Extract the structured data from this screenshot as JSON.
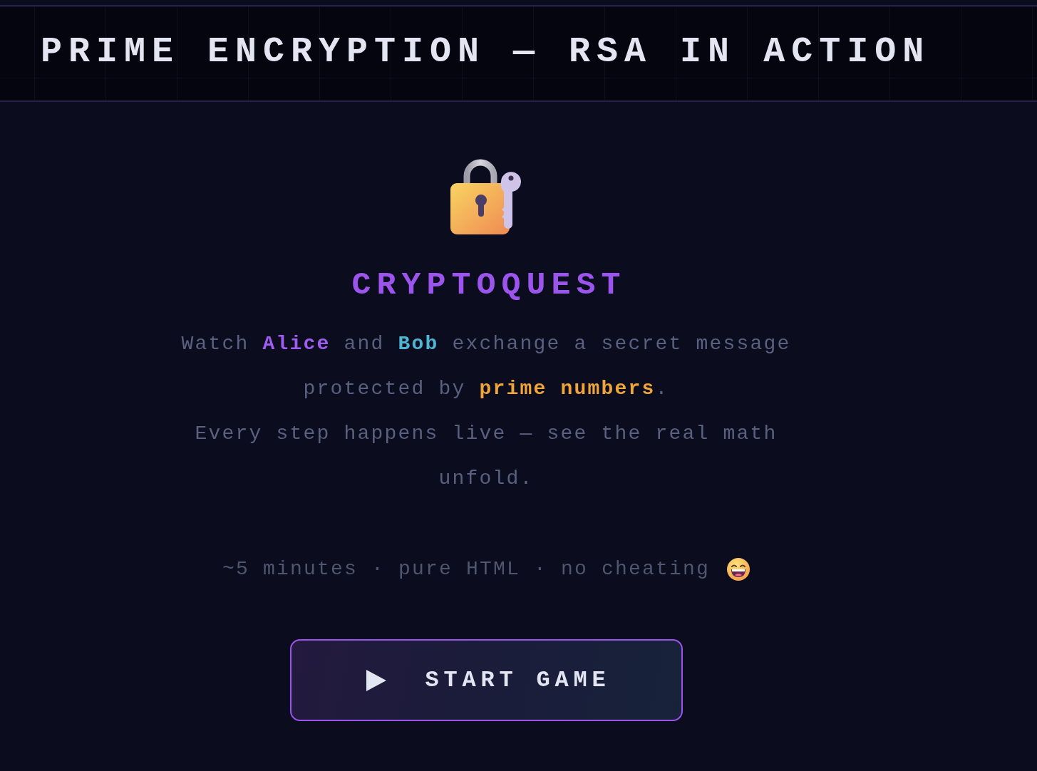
{
  "header": {
    "title": "PRIME ENCRYPTION — RSA IN ACTION"
  },
  "hero": {
    "title": "CRYPTOQUEST",
    "intro": [
      {
        "text": "Watch "
      },
      {
        "text": "Alice",
        "color": "#a05cf0"
      },
      {
        "text": " and "
      },
      {
        "text": "Bob",
        "color": "#4db6d2"
      },
      {
        "text": " exchange a secret message protected by "
      },
      {
        "text": "prime numbers",
        "color": "#f0a53a"
      },
      {
        "text": "."
      }
    ],
    "note": "Every step happens live — see the real math unfold.",
    "meta": "~5 minutes · pure HTML · no cheating",
    "start_button": {
      "label": "START GAME"
    }
  }
}
